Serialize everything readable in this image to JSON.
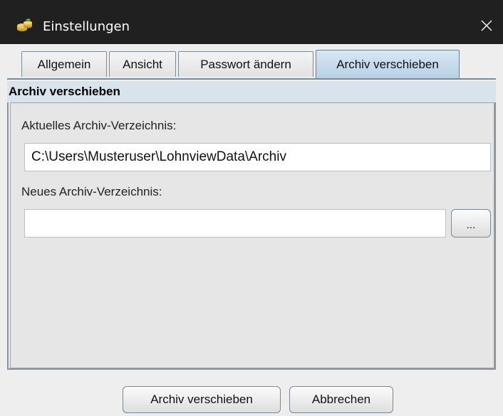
{
  "window": {
    "title": "Einstellungen",
    "icon": "coins-icon",
    "close_icon": "close-icon"
  },
  "tabs": [
    {
      "label": "Allgemein",
      "active": false
    },
    {
      "label": "Ansicht",
      "active": false
    },
    {
      "label": "Passwort ändern",
      "active": false
    },
    {
      "label": "Archiv verschieben",
      "active": true
    }
  ],
  "panel": {
    "header": "Archiv verschieben",
    "current_label": "Aktuelles Archiv-Verzeichnis:",
    "current_value": "C:\\Users\\Musteruser\\LohnviewData\\Archiv",
    "new_label": "Neues Archiv-Verzeichnis:",
    "new_value": "",
    "browse_label": "..."
  },
  "footer": {
    "move_button": "Archiv verschieben",
    "cancel_button": "Abbrechen"
  },
  "colors": {
    "titlebar": "#202020",
    "active_tab": "#b8d0e6",
    "panel_header": "#d9e3ec"
  }
}
